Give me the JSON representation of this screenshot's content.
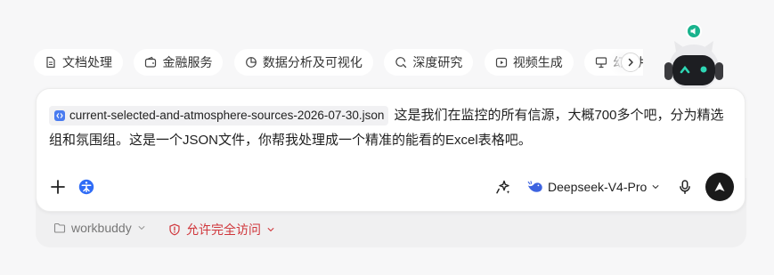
{
  "chips": [
    {
      "label": "文档处理",
      "icon": "document-icon"
    },
    {
      "label": "金融服务",
      "icon": "wallet-icon"
    },
    {
      "label": "数据分析及可视化",
      "icon": "pie-chart-icon"
    },
    {
      "label": "深度研究",
      "icon": "search-research-icon"
    },
    {
      "label": "视频生成",
      "icon": "video-icon"
    },
    {
      "label": "幻灯片",
      "icon": "presentation-icon"
    }
  ],
  "input": {
    "file_name": "current-selected-and-atmosphere-sources-2026-07-30.json",
    "message": "这是我们在监控的所有信源，大概700多个吧，分为精选组和氛围组。这是一个JSON文件，你帮我处理成一个精准的能看的Excel表格吧。"
  },
  "model": {
    "label": "Deepseek-V4-Pro"
  },
  "footer": {
    "workspace": "workbuddy",
    "access": "允许完全访问"
  },
  "colors": {
    "accent": "#2f6cf6",
    "danger": "#d0363b",
    "mascot_badge": "#19b38d"
  }
}
